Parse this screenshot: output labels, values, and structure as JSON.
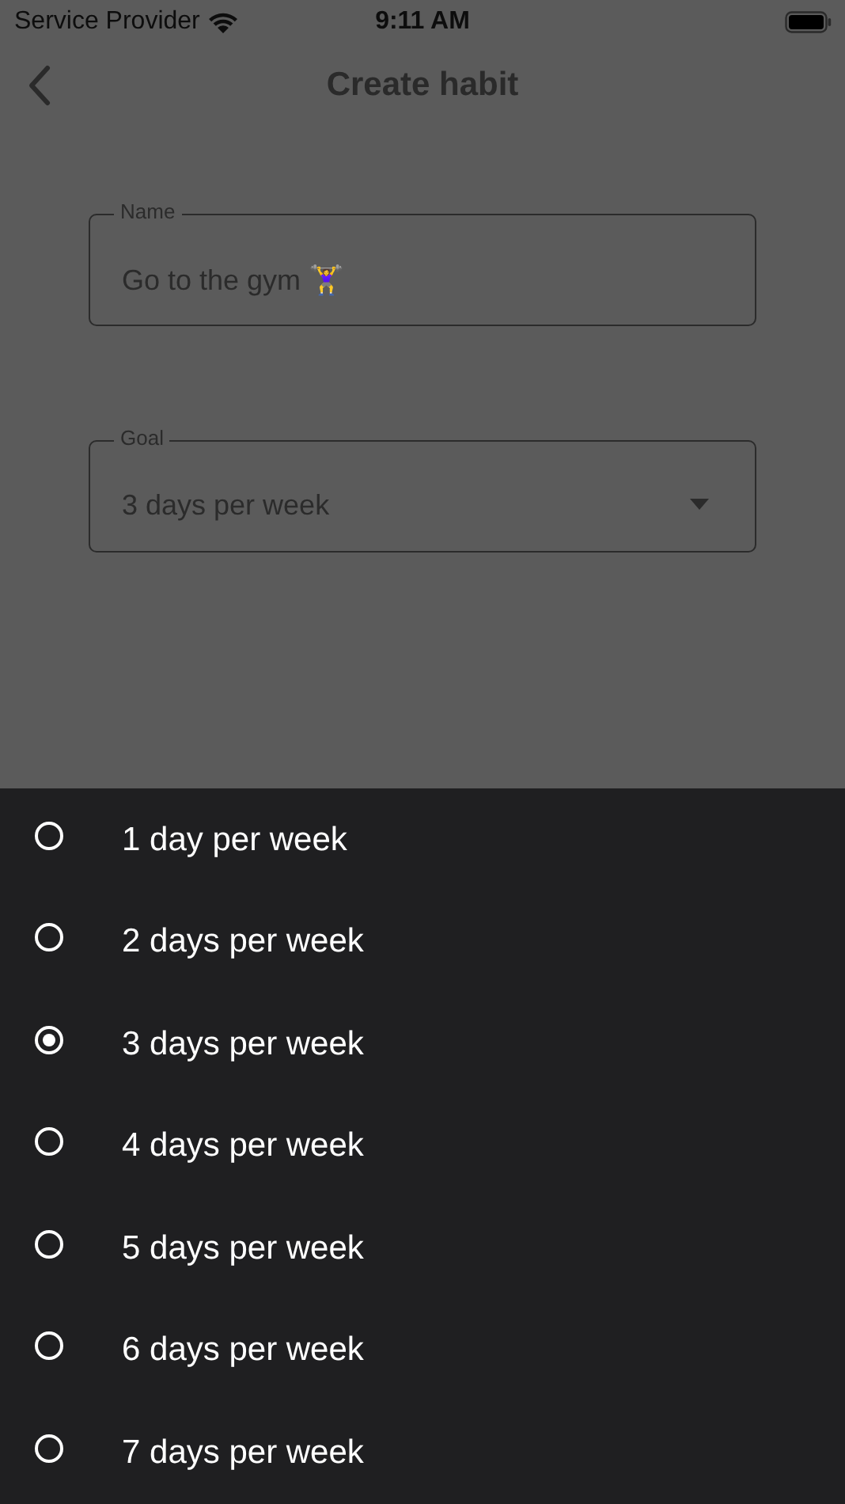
{
  "status_bar": {
    "carrier": "Service Provider",
    "time": "9:11 AM"
  },
  "header": {
    "title": "Create habit"
  },
  "name_field": {
    "label": "Name",
    "value": "Go to the gym 🏋️‍♀️"
  },
  "goal_field": {
    "label": "Goal",
    "value": "3 days per week"
  },
  "goal_options": [
    {
      "label": "1 day per week",
      "selected": false
    },
    {
      "label": "2 days per week",
      "selected": false
    },
    {
      "label": "3 days per week",
      "selected": true
    },
    {
      "label": "4 days per week",
      "selected": false
    },
    {
      "label": "5 days per week",
      "selected": false
    },
    {
      "label": "6 days per week",
      "selected": false
    },
    {
      "label": "7 days per week",
      "selected": false
    }
  ]
}
